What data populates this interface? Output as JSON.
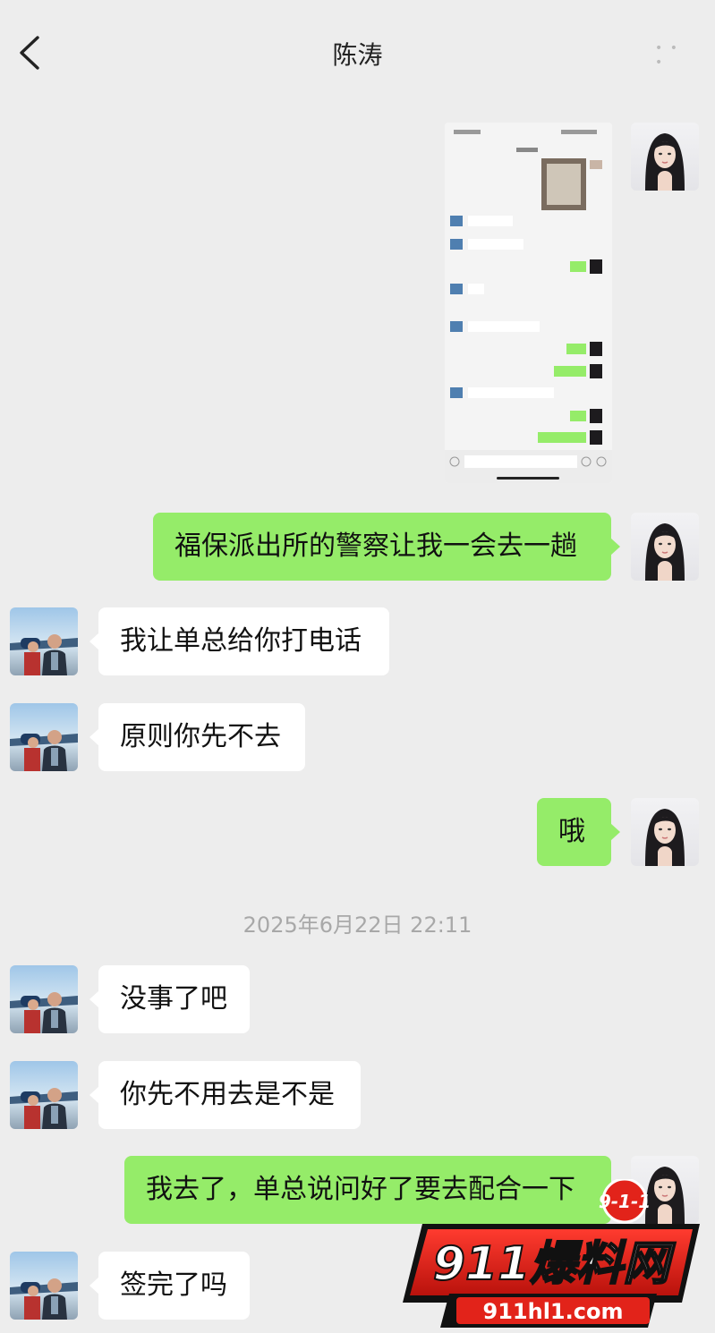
{
  "header": {
    "title": "陈涛",
    "more_icon": "ellipsis-icon"
  },
  "messages": [
    {
      "side": "self",
      "type": "image",
      "description_icon": "chat-screenshot-image"
    },
    {
      "side": "self",
      "text": "福保派出所的警察让我一会去一趟"
    },
    {
      "side": "other",
      "text": "我让单总给你打电话"
    },
    {
      "side": "other",
      "text": "原则你先不去"
    },
    {
      "side": "self",
      "text": "哦"
    },
    {
      "side": "other",
      "text": "没事了吧"
    },
    {
      "side": "other",
      "text": "你先不用去是不是"
    },
    {
      "side": "self",
      "text": "我去了，单总说问好了要去配合一下"
    },
    {
      "side": "other",
      "text": "签完了吗"
    }
  ],
  "timestamp": "2025年6月22日 22:11",
  "watermark": {
    "badge": "9-1-1",
    "brand": "911爆料网",
    "url": "911hl1.com"
  },
  "colors": {
    "background": "#ededed",
    "self_bubble": "#95ec69",
    "other_bubble": "#ffffff",
    "watermark_red": "#e2231a"
  }
}
